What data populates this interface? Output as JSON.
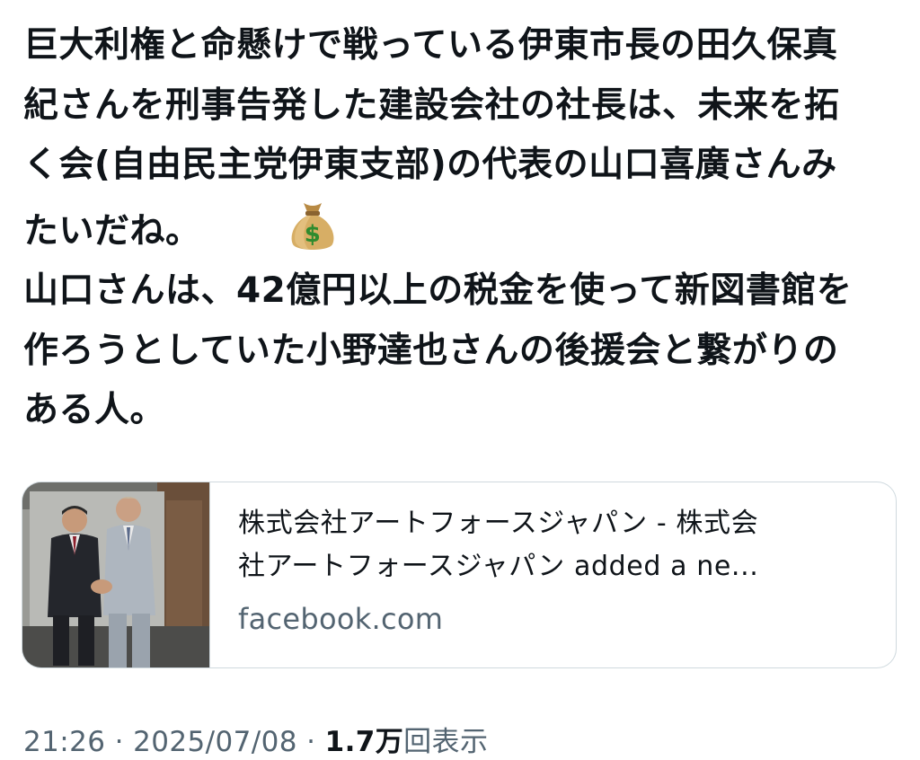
{
  "tweet": {
    "lines": [
      "巨大利権と命懸けで戦っている伊東市長の田久保真",
      "紀さんを刑事告発した建設会社の社長は、未来を拓",
      "く会(自由民主党伊東支部)の代表の山口喜廣さんみ",
      "たいだね。",
      "山口さんは、42億円以上の税金を使って新図書館を",
      "作ろうとしていた小野達也さんの後援会と繋がりの",
      "ある人。"
    ],
    "emoji_name": "money-bag-icon"
  },
  "card": {
    "title_line1": "株式会社アートフォースジャパン - 株式会",
    "title_line2": "社アートフォースジャパン added a ne...",
    "domain": "facebook.com"
  },
  "meta": {
    "time": "21:26",
    "date": "2025/07/08",
    "separator": "·",
    "views_count": "1.7万",
    "views_label": "回表示"
  },
  "colors": {
    "text": "#0f1419",
    "secondary": "#536471",
    "border": "#cfd9de",
    "emoji_bag": "#c9a25a",
    "emoji_dollar": "#2e8b2e"
  }
}
